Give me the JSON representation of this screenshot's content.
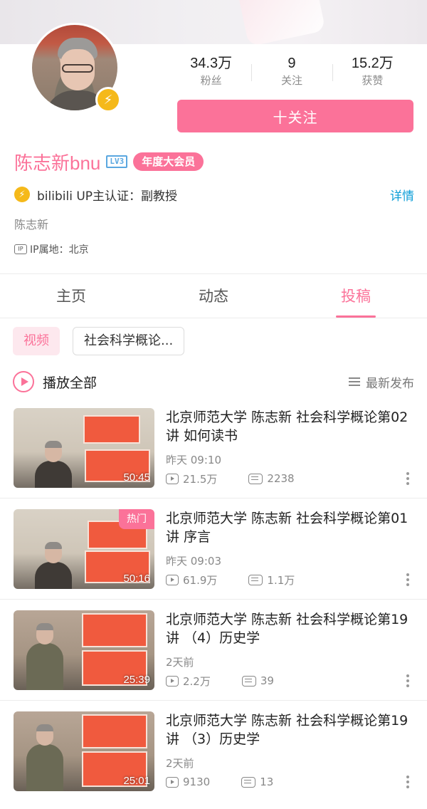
{
  "profile": {
    "user_name": "陈志新bnu",
    "level_badge": "LV3",
    "vip_badge": "年度大会员",
    "cert_text": "bilibili UP主认证：副教授",
    "cert_more": "详情",
    "signature": "陈志新",
    "ip_icon": "IP",
    "ip_location": "IP属地：北京",
    "follow_label": "十关注",
    "stats": [
      {
        "value": "34.3万",
        "label": "粉丝"
      },
      {
        "value": "9",
        "label": "关注"
      },
      {
        "value": "15.2万",
        "label": "获赞"
      }
    ]
  },
  "tabs": [
    {
      "label": "主页",
      "active": false
    },
    {
      "label": "动态",
      "active": false
    },
    {
      "label": "投稿",
      "active": true
    }
  ],
  "filters": {
    "selected": "视频",
    "option": "社会科学概论..."
  },
  "playall": {
    "label": "播放全部",
    "sort_label": "最新发布"
  },
  "videos": [
    {
      "title": "北京师范大学 陈志新 社会科学概论第02讲 如何读书",
      "date": "昨天 09:10",
      "views": "21.5万",
      "danmaku": "2238",
      "duration": "50:45",
      "badge": ""
    },
    {
      "title": "北京师范大学 陈志新 社会科学概论第01讲 序言",
      "date": "昨天 09:03",
      "views": "61.9万",
      "danmaku": "1.1万",
      "duration": "50:16",
      "badge": "热门"
    },
    {
      "title": "北京师范大学 陈志新 社会科学概论第19讲 （4）历史学",
      "date": "2天前",
      "views": "2.2万",
      "danmaku": "39",
      "duration": "25:39",
      "badge": ""
    },
    {
      "title": "北京师范大学 陈志新 社会科学概论第19讲 （3）历史学",
      "date": "2天前",
      "views": "9130",
      "danmaku": "13",
      "duration": "25:01",
      "badge": ""
    }
  ],
  "colors": {
    "accent": "#fb7299",
    "link": "#0f9fd8",
    "verify": "#f5b91a"
  },
  "icons": {
    "verify": "lightning-icon",
    "play_all": "play-circle-icon",
    "sort": "list-sort-icon",
    "views": "play-count-icon",
    "danmaku": "danmaku-icon",
    "more": "more-vertical-icon",
    "ip": "ip-icon"
  }
}
